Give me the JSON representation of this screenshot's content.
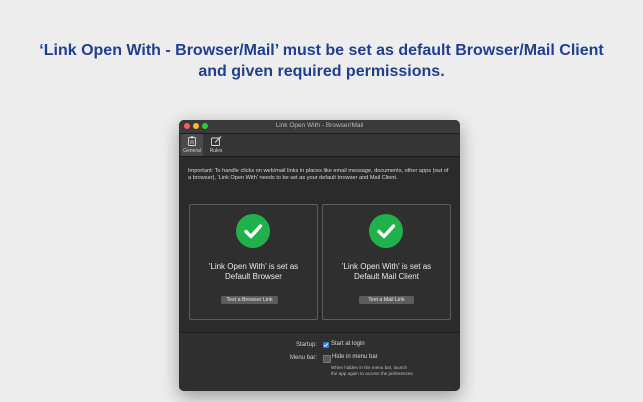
{
  "headline": {
    "line1": "‘Link Open With - Browser/Mail’ must be set as default Browser/Mail Client",
    "line2": "and given required permissions."
  },
  "window": {
    "title": "Link Open With - Browser/Mail",
    "tabs": [
      {
        "label": "General",
        "icon": "general-icon"
      },
      {
        "label": "Rules",
        "icon": "rules-edit-icon"
      }
    ],
    "important_text": "Important: To handle clicks on web/mail links in places like email message, documents, other apps (out of a browser), 'Link Open With' needs to be set as your default browser and Mail Client.",
    "cards": [
      {
        "line1": "'Link Open With' is set as",
        "line2": "Default Browser",
        "button": "Test a Browser Link",
        "icon": "checkmark-icon"
      },
      {
        "line1": "'Link Open With' is set as",
        "line2": "Default Mail Client",
        "button": "Test a Mail Link",
        "icon": "checkmark-icon"
      }
    ],
    "settings": {
      "startup_label": "Startup:",
      "startup_option": "Start at login",
      "startup_checked": true,
      "menubar_label": "Menu bar:",
      "menubar_option": "Hide in menu bar",
      "menubar_checked": false,
      "hint_line1": "When hidden in the menu bar, launch",
      "hint_line2": "the app again to access the preferences"
    }
  },
  "colors": {
    "headline": "#1f3f8f",
    "check_green": "#21b14b",
    "checkbox_blue": "#2b7de9"
  }
}
